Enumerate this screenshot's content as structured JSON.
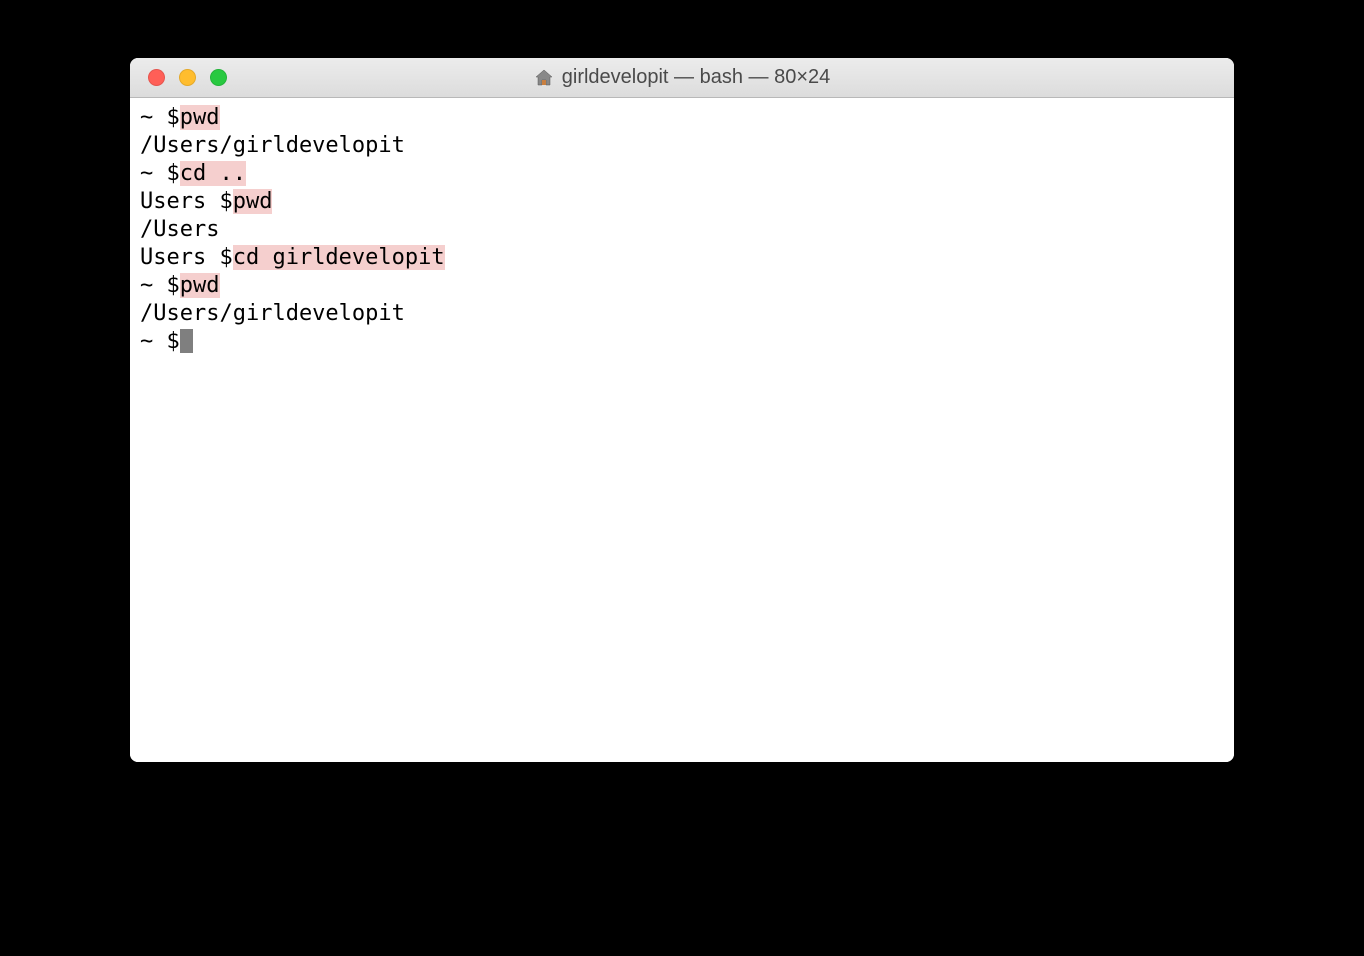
{
  "window": {
    "title": "girldevelopit — bash — 80×24"
  },
  "terminal": {
    "lines": [
      {
        "prompt": "~ $",
        "command": "pwd",
        "output": "/Users/girldevelopit"
      },
      {
        "prompt": "~ $",
        "command": "cd ..",
        "output": ""
      },
      {
        "prompt": "Users $",
        "command": "pwd",
        "output": "/Users"
      },
      {
        "prompt": "Users $",
        "command": "cd girldevelopit",
        "output": ""
      },
      {
        "prompt": "~ $",
        "command": "pwd",
        "output": "/Users/girldevelopit"
      }
    ],
    "current_prompt": "~ $"
  }
}
